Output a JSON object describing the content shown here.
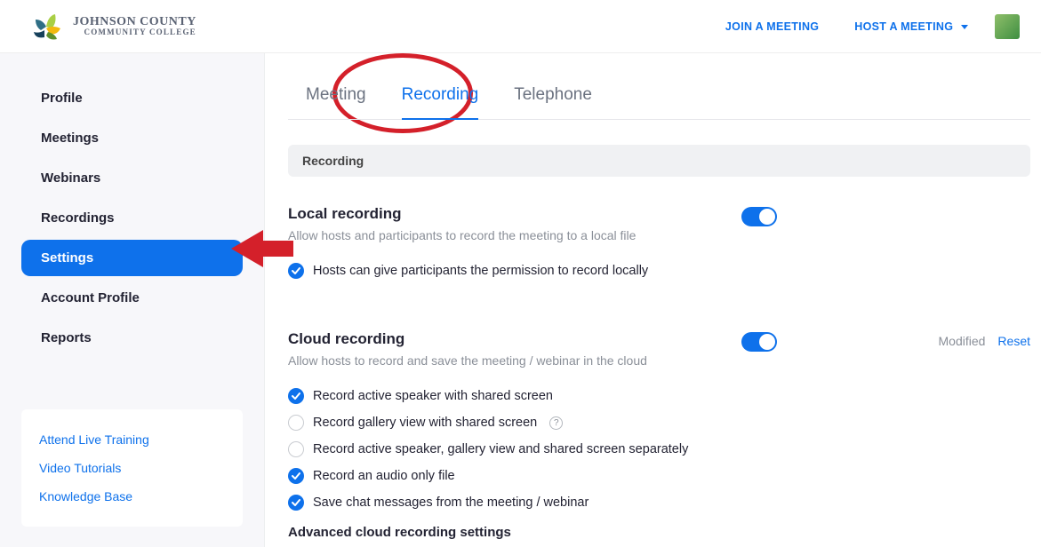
{
  "header": {
    "org_line1": "JOHNSON COUNTY",
    "org_line2": "COMMUNITY COLLEGE",
    "join_label": "JOIN A MEETING",
    "host_label": "HOST A MEETING"
  },
  "sidebar": {
    "items": [
      {
        "label": "Profile"
      },
      {
        "label": "Meetings"
      },
      {
        "label": "Webinars"
      },
      {
        "label": "Recordings"
      },
      {
        "label": "Settings"
      },
      {
        "label": "Account Profile"
      },
      {
        "label": "Reports"
      }
    ],
    "links": [
      {
        "label": "Attend Live Training"
      },
      {
        "label": "Video Tutorials"
      },
      {
        "label": "Knowledge Base"
      }
    ]
  },
  "tabs": [
    {
      "label": "Meeting"
    },
    {
      "label": "Recording"
    },
    {
      "label": "Telephone"
    }
  ],
  "banner": "Recording",
  "settings": {
    "local_recording": {
      "title": "Local recording",
      "desc": "Allow hosts and participants to record the meeting to a local file",
      "opt_hosts_permission": "Hosts can give participants the permission to record locally"
    },
    "cloud_recording": {
      "title": "Cloud recording",
      "desc": "Allow hosts to record and save the meeting / webinar in the cloud",
      "modified": "Modified",
      "reset": "Reset",
      "opts": [
        "Record active speaker with shared screen",
        "Record gallery view with shared screen",
        "Record active speaker, gallery view and shared screen separately",
        "Record an audio only file",
        "Save chat messages from the meeting / webinar"
      ],
      "advanced_heading": "Advanced cloud recording settings"
    }
  }
}
